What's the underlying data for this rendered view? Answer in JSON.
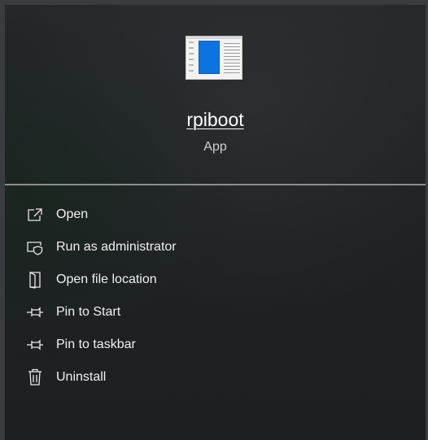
{
  "app": {
    "name": "rpiboot",
    "type": "App",
    "icon": "app-window-icon",
    "icon_accent": "#0a74e0"
  },
  "menu": {
    "items": [
      {
        "label": "Open",
        "icon": "open-external-icon"
      },
      {
        "label": "Run as administrator",
        "icon": "shield-admin-icon"
      },
      {
        "label": "Open file location",
        "icon": "folder-location-icon"
      },
      {
        "label": "Pin to Start",
        "icon": "pin-icon"
      },
      {
        "label": "Pin to taskbar",
        "icon": "pin-icon"
      },
      {
        "label": "Uninstall",
        "icon": "trash-icon"
      }
    ]
  },
  "colors": {
    "background": "#1f2124",
    "text": "#f0f0f0",
    "divider": "#8c8d90"
  }
}
